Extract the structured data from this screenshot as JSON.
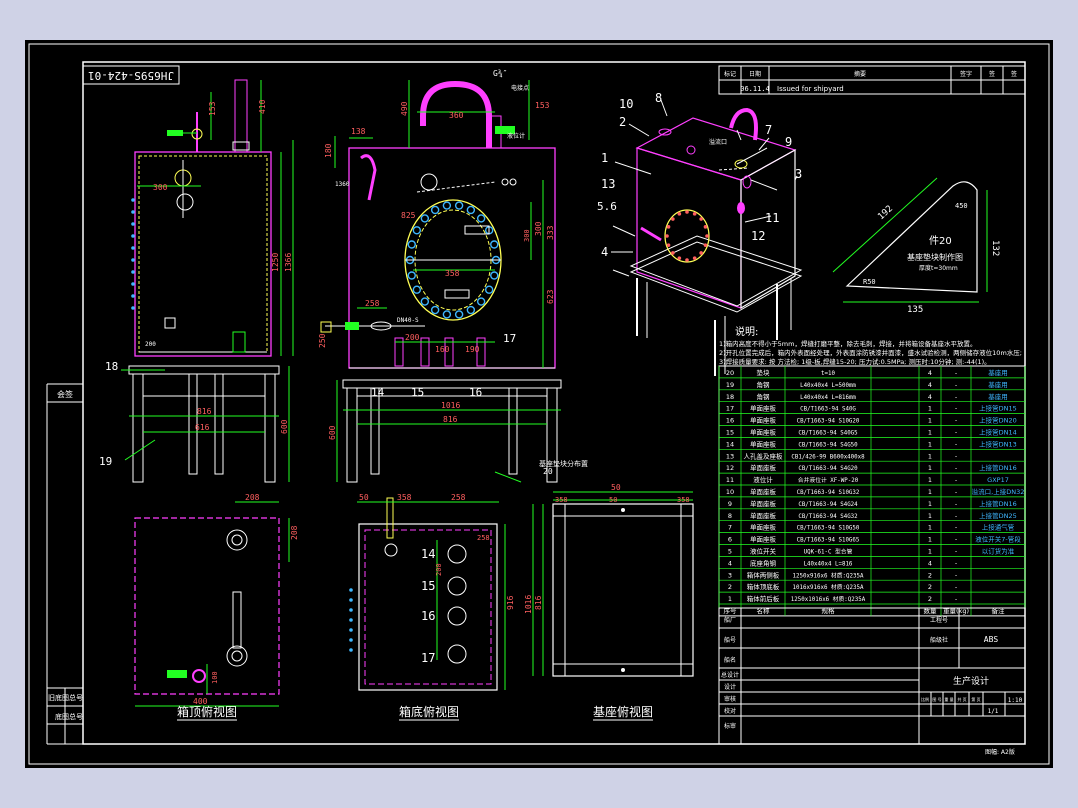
{
  "drawing_number": "JH659S-424-01",
  "approval": {
    "date": "06.11.4",
    "note": "Issued for shipyard"
  },
  "rev_header": [
    "标记",
    "日期",
    "摘要",
    "签字",
    "签",
    "签"
  ],
  "views": {
    "top": "箱顶俯视图",
    "bottom": "箱底俯视图",
    "base": "基座俯视图"
  },
  "side_labels": [
    "会签",
    "旧底图总号",
    "底图总号"
  ],
  "part20": {
    "title": "件20",
    "subtitle": "基座垫块制作图",
    "note": "厚度t=30mm",
    "dim_a": "192",
    "dim_b": "450",
    "dim_c": "132",
    "dim_d": "135",
    "dim_e": "R50"
  },
  "notes_title": "说明:",
  "notes": [
    "1)箱内高度不得小于5mm，焊缝打磨平整，除去毛刺，焊接，并将箱设备基座水平放置。",
    "2)开孔位置完成后，箱内外表面经处理，外表面涂防锈漆并面漆，盛水试验检测，两侧储存液位10m水压;",
    "3)焊接质量要求: 按 方法检; 1级-板,焊缝15-20; 压力试:0.5MPa; 测压时:10分钟; 测:-44(1)。"
  ],
  "callouts": {
    "main": [
      "410",
      "153",
      "300",
      "1250",
      "1366",
      "600",
      "816",
      "616",
      "200",
      "18",
      "19"
    ],
    "front": [
      "G¾″",
      "490",
      "360",
      "153",
      "138",
      "180",
      "1360",
      "258",
      "DN40-S",
      "250",
      "200",
      "160",
      "190",
      "1016",
      "816",
      "600",
      "14",
      "15",
      "16",
      "17",
      "20",
      "基座垫块分布置",
      "825",
      "300",
      "300",
      "333",
      "358",
      "623",
      "电接点",
      "液位计"
    ],
    "iso": [
      "1",
      "2",
      "3",
      "4",
      "5.6",
      "7",
      "8",
      "9",
      "10",
      "11",
      "12",
      "13",
      "溢流口"
    ],
    "plan": [
      "208",
      "208",
      "400",
      "100",
      "50",
      "358",
      "258",
      "258",
      "200",
      "14",
      "15",
      "16",
      "17",
      "916",
      "1016",
      "816",
      "50",
      "358",
      "50"
    ]
  },
  "bom_headers": [
    "序号",
    "名称",
    "规格",
    "数量",
    "重量(kg)",
    "备注"
  ],
  "bom": [
    [
      "20",
      "垫块",
      "t=10",
      "4",
      "-",
      "基座用"
    ],
    [
      "19",
      "角钢",
      "L40x40x4 L=500mm",
      "4",
      "-",
      "基座用"
    ],
    [
      "18",
      "角钢",
      "L40x40x4 L=816mm",
      "4",
      "-",
      "基座用"
    ],
    [
      "17",
      "单面座板",
      "CB/T1663-94 S40G",
      "1",
      "-",
      "上接管DN15"
    ],
    [
      "16",
      "单面座板",
      "CB/T1663-94 S10G20",
      "1",
      "-",
      "上接管DN20"
    ],
    [
      "15",
      "单面座板",
      "CB/T1663-94 S40G5",
      "1",
      "-",
      "上接管DN14"
    ],
    [
      "14",
      "单面座板",
      "CB/T1663-94 S4G50",
      "1",
      "-",
      "上接管DN13"
    ],
    [
      "13",
      "人孔盖及座板",
      "CB1/426-99 B600x400x8",
      "1",
      "-",
      ""
    ],
    [
      "12",
      "单面座板",
      "CB/T1663-94 S4G20",
      "1",
      "-",
      "上接管DN16"
    ],
    [
      "11",
      "液位计",
      "合并液位计 XF-WP-20",
      "1",
      "-",
      "GXP17"
    ],
    [
      "10",
      "单面座板",
      "CB/T1663-94 S10G32",
      "1",
      "-",
      "溢流口,上接DN32"
    ],
    [
      "9",
      "单面座板",
      "CB/T1663-94 S4G24",
      "1",
      "-",
      "上接管DN16"
    ],
    [
      "8",
      "单面座板",
      "CB/T1663-94 S4G32",
      "1",
      "-",
      "上接管DN25"
    ],
    [
      "7",
      "单面座板",
      "CB/T1663-94 S10G50",
      "1",
      "-",
      "上接通气管"
    ],
    [
      "6",
      "单面座板",
      "CB/T1663-94 S10G65",
      "1",
      "-",
      "液位开关7-管段"
    ],
    [
      "5",
      "液位开关",
      "UQK-61-C 型合管",
      "1",
      "-",
      "以订货为准"
    ],
    [
      "4",
      "底座角钢",
      "L40x40x4 L=816",
      "4",
      "-",
      ""
    ],
    [
      "3",
      "箱体两侧板",
      "1250x916x6  材质:Q235A",
      "2",
      "-",
      ""
    ],
    [
      "2",
      "箱体顶底板",
      "1016x916x6  材质:Q235A",
      "2",
      "-",
      ""
    ],
    [
      "1",
      "箱体前后板",
      "1250x1016x6  材质:Q235A",
      "2",
      "-",
      ""
    ]
  ],
  "title_block": {
    "rows": [
      "船厂",
      "船号",
      "船名",
      "总设计",
      "设计",
      "审核",
      "校对",
      "标审"
    ],
    "design_no_label": "工程号",
    "spec_label": "船级社",
    "spec_value": "ABS",
    "design_title": "生产设计",
    "stage_labels": [
      "比例",
      "图 号",
      "重 量",
      "共 页",
      "第 页"
    ],
    "scale": "1:10",
    "sheet": "1/1",
    "footer": "图幅: A2版"
  }
}
